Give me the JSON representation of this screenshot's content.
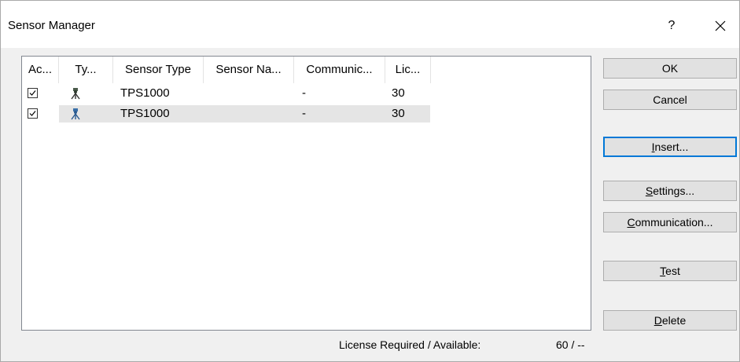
{
  "window": {
    "title": "Sensor Manager",
    "help_label": "?"
  },
  "list": {
    "columns": [
      {
        "label": "Ac..."
      },
      {
        "label": "Ty..."
      },
      {
        "label": "Sensor Type"
      },
      {
        "label": "Sensor Na..."
      },
      {
        "label": "Communic..."
      },
      {
        "label": "Lic..."
      }
    ],
    "rows": [
      {
        "active": true,
        "type_icon": "instrument-icon",
        "sensor_type": "TPS1000",
        "sensor_name": "",
        "communication": "-",
        "license": "30"
      },
      {
        "active": true,
        "type_icon": "instrument-icon",
        "sensor_type": "TPS1000",
        "sensor_name": "",
        "communication": "-",
        "license": "30"
      }
    ]
  },
  "buttons": {
    "ok": {
      "label": "OK"
    },
    "cancel": {
      "label": "Cancel"
    },
    "insert": {
      "mnemonic": "I",
      "rest": "nsert..."
    },
    "settings": {
      "mnemonic": "S",
      "rest": "ettings..."
    },
    "communication": {
      "mnemonic": "C",
      "rest": "ommunication..."
    },
    "test": {
      "mnemonic": "T",
      "rest": "est"
    },
    "delete": {
      "mnemonic": "D",
      "rest": "elete"
    }
  },
  "status": {
    "label": "License Required / Available:",
    "value": "60 / --"
  },
  "colors": {
    "focus_border": "#0078d7",
    "selected_row": "#e5e5e5"
  }
}
